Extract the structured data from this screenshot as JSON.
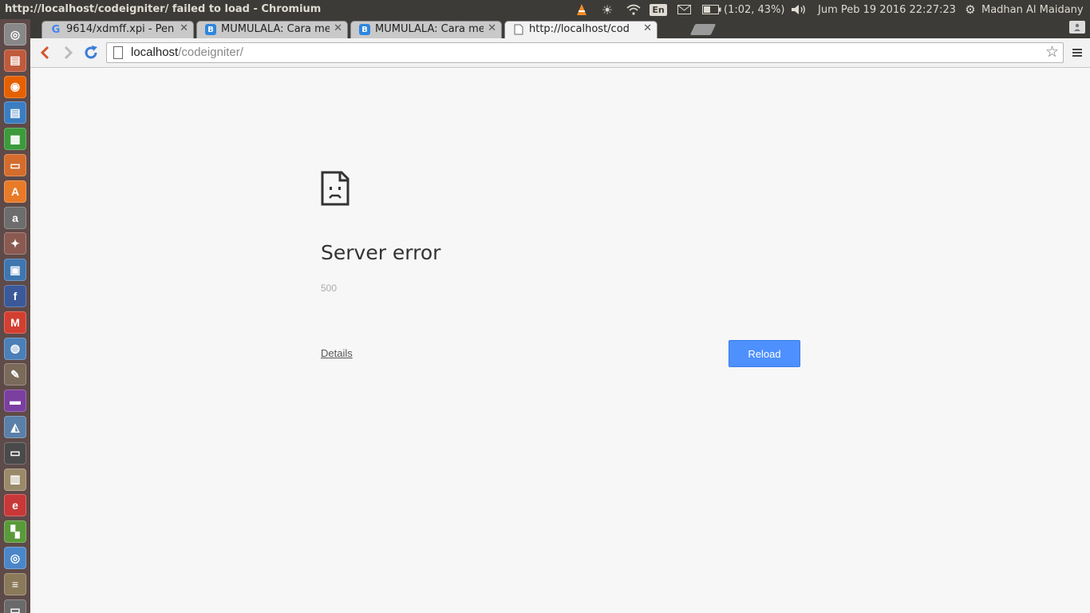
{
  "topbar": {
    "window_title": "http://localhost/codeigniter/ failed to load - Chromium",
    "keyboard": "En",
    "battery": "(1:02, 43%)",
    "datetime": "Jum Peb 19 2016 22:27:23",
    "user": "Madhan Al Maidany"
  },
  "launcher": {
    "items": [
      {
        "name": "dash-home-icon",
        "glyph": "◎",
        "color": "#888888"
      },
      {
        "name": "files-icon",
        "glyph": "▤",
        "color": "#c05a3c"
      },
      {
        "name": "firefox-icon",
        "glyph": "◉",
        "color": "#e66000"
      },
      {
        "name": "writer-icon",
        "glyph": "▤",
        "color": "#3b7dc2"
      },
      {
        "name": "calc-icon",
        "glyph": "▦",
        "color": "#3c9a3c"
      },
      {
        "name": "impress-icon",
        "glyph": "▭",
        "color": "#d36c2c"
      },
      {
        "name": "software-center-icon",
        "glyph": "A",
        "color": "#e87a28"
      },
      {
        "name": "amazon-icon",
        "glyph": "a",
        "color": "#6d6d6d"
      },
      {
        "name": "system-settings-icon",
        "glyph": "✦",
        "color": "#8a5a52"
      },
      {
        "name": "monitor-icon",
        "glyph": "▣",
        "color": "#3f76b0"
      },
      {
        "name": "facebook-icon",
        "glyph": "f",
        "color": "#3b5998"
      },
      {
        "name": "gmail-icon",
        "glyph": "M",
        "color": "#d23f31"
      },
      {
        "name": "network-icon",
        "glyph": "◍",
        "color": "#4b7fb8"
      },
      {
        "name": "text-editor-icon",
        "glyph": "✎",
        "color": "#7a6a5a"
      },
      {
        "name": "media-app-icon",
        "glyph": "▬",
        "color": "#7a3fa0"
      },
      {
        "name": "image-viewer-icon",
        "glyph": "◭",
        "color": "#5a7fa8"
      },
      {
        "name": "terminal-icon",
        "glyph": "▭",
        "color": "#4a4a4a"
      },
      {
        "name": "archive-icon",
        "glyph": "▥",
        "color": "#9a8a6a"
      },
      {
        "name": "app-e-icon",
        "glyph": "e",
        "color": "#c83838"
      },
      {
        "name": "multicolor-app-icon",
        "glyph": "▚",
        "color": "#5a9a3a"
      },
      {
        "name": "chromium-icon",
        "glyph": "◎",
        "color": "#4a86c8"
      },
      {
        "name": "stacked-app-icon",
        "glyph": "≡",
        "color": "#8a7a5a"
      },
      {
        "name": "trash-icon",
        "glyph": "▭",
        "color": "#6a6a6a"
      }
    ]
  },
  "tabs": [
    {
      "label": "9614/xdmff.xpi - Pen",
      "icon": "G",
      "icon_color": "#4285f4",
      "active": false
    },
    {
      "label": "MUMULALA: Cara me",
      "icon": "B",
      "icon_color": "#2e86de",
      "active": false
    },
    {
      "label": "MUMULALA: Cara me",
      "icon": "B",
      "icon_color": "#2e86de",
      "active": false
    },
    {
      "label": "http://localhost/cod",
      "icon": "page",
      "icon_color": "#666666",
      "active": true
    }
  ],
  "omnibox": {
    "host": "localhost",
    "path": "/codeigniter/"
  },
  "error": {
    "title": "Server error",
    "code": "500",
    "details_label": "Details",
    "reload_label": "Reload"
  },
  "colors": {
    "accent": "#4d90fe",
    "panel": "#3c3b37",
    "launcher": "#5e4a48"
  }
}
